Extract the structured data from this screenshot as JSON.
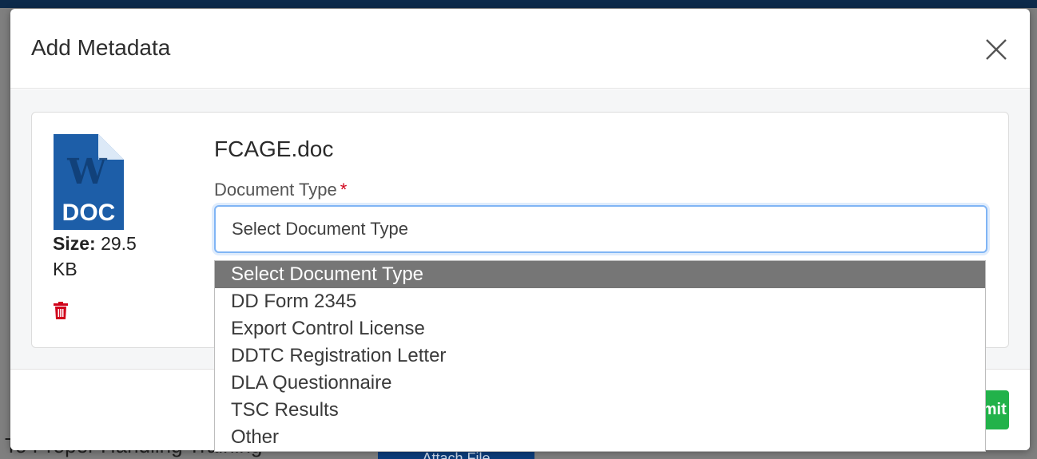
{
  "background": {
    "fragment_text": "To Proper Handling Training",
    "attach_label": "Attach File"
  },
  "modal": {
    "title": "Add Metadata",
    "close_icon": "close-icon"
  },
  "file": {
    "name": "FCAGE.doc",
    "icon": "word-doc-icon",
    "icon_label": "DOC",
    "size_label": "Size:",
    "size_value": "29.5 KB",
    "delete_icon": "trash-icon"
  },
  "document_type": {
    "label": "Document Type",
    "required_mark": "*",
    "selected": "Select Document Type",
    "options": [
      "Select Document Type",
      "DD Form 2345",
      "Export Control License",
      "DDTC Registration Letter",
      "DLA Questionnaire",
      "TSC Results",
      "Other"
    ]
  },
  "footer": {
    "submit_label": "Submit"
  },
  "colors": {
    "accent_blue": "#80b5f5",
    "submit_green": "#22b24a",
    "required_red": "#d0021b",
    "selected_option_bg": "#767676",
    "word_blue": "#1d5ea8"
  }
}
